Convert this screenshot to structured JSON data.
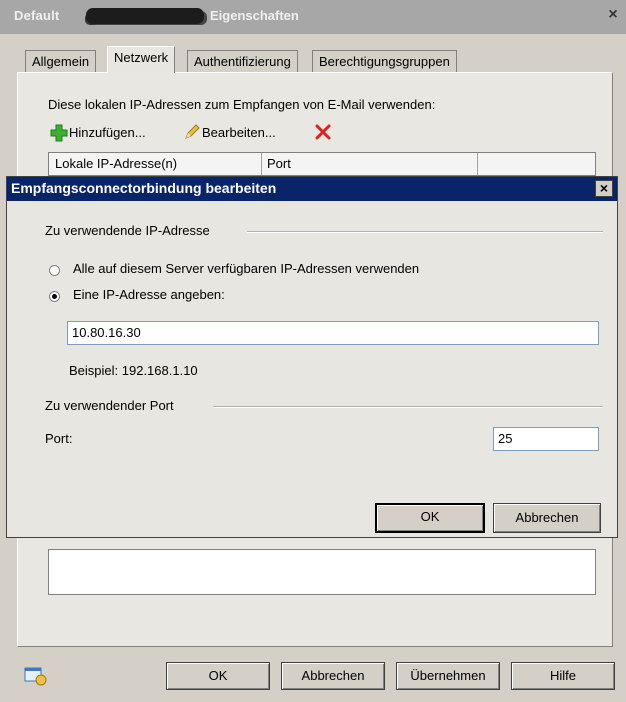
{
  "parent": {
    "title_prefix": "Default",
    "title_suffix": "Eigenschaften",
    "tabs": [
      {
        "label": "Allgemein"
      },
      {
        "label": "Netzwerk"
      },
      {
        "label": "Authentifizierung"
      },
      {
        "label": "Berechtigungsgruppen"
      }
    ],
    "intro_text": "Diese lokalen IP-Adressen zum Empfangen von E-Mail verwenden:",
    "toolbar": {
      "add_label": "Hinzufügen...",
      "edit_label": "Bearbeiten..."
    },
    "list_columns": [
      "Lokale IP-Adresse(n)",
      "Port"
    ],
    "buttons": {
      "ok": "OK",
      "cancel": "Abbrechen",
      "apply": "Übernehmen",
      "help": "Hilfe"
    }
  },
  "dialog": {
    "title": "Empfangsconnectorbindung bearbeiten",
    "ip_group_label": "Zu verwendende IP-Adresse",
    "radio_all_label": "Alle auf diesem Server verfügbaren IP-Adressen verwenden",
    "radio_specific_label": "Eine IP-Adresse angeben:",
    "selected_option": "specific",
    "ip_value": "10.80.16.30",
    "example_text": "Beispiel: 192.168.1.10",
    "port_group_label": "Zu verwendender Port",
    "port_label": "Port:",
    "port_value": "25",
    "ok_label": "OK",
    "cancel_label": "Abbrechen"
  },
  "colors": {
    "dialog_titlebar": "#0a246a",
    "inactive_titlebar": "#a7a7a7",
    "delete_icon": "#e02020",
    "add_icon": "#3cb030"
  }
}
